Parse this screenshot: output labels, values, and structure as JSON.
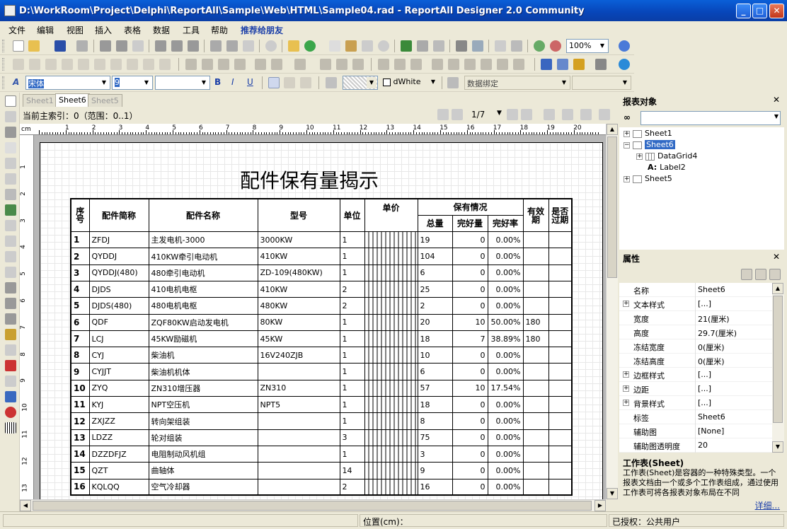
{
  "window": {
    "title": "D:\\WorkRoom\\Project\\Delphi\\ReportAll\\Sample\\Web\\HTML\\Sample04.rad - ReportAll Designer 2.0 Community"
  },
  "menu": [
    "文件",
    "编辑",
    "视图",
    "插入",
    "表格",
    "数据",
    "工具",
    "帮助",
    "推荐给朋友"
  ],
  "toolbar": {
    "zoom": "100%",
    "font_name": "宋体",
    "font_size": "9",
    "bg_color": "dWhite",
    "data_bind_label": "数据绑定"
  },
  "tabs": [
    "Sheet1",
    "Sheet6",
    "Sheet5"
  ],
  "doc_status": "当前主索引：0（范围：0..1）",
  "pager": "1/7",
  "ruler": [
    "1",
    "2",
    "3",
    "4",
    "5",
    "6",
    "7",
    "8",
    "9",
    "10",
    "11",
    "12",
    "13",
    "14",
    "15",
    "16",
    "17",
    "18",
    "19",
    "20"
  ],
  "ruler_v": [
    "1",
    "2",
    "3",
    "4",
    "5",
    "6",
    "7",
    "8",
    "9",
    "10",
    "11",
    "12",
    "13"
  ],
  "ruler_unit": "cm",
  "report": {
    "title": "配件保有量揭示",
    "headers": {
      "seq": "序号",
      "short": "配件简称",
      "name": "配件名称",
      "model": "型号",
      "unit": "单位",
      "price": "单价",
      "holding": "保有情况",
      "total": "总量",
      "good": "完好量",
      "rate": "完好率",
      "valid": "有效期",
      "expired": "是否过期"
    },
    "rows": [
      {
        "n": "1",
        "short": "ZFDJ",
        "name": "主发电机-3000",
        "model": "3000KW",
        "unit": "1",
        "total": "19",
        "good": "0",
        "rate": "0.00%",
        "valid": ""
      },
      {
        "n": "2",
        "short": "QYDDJ",
        "name": "410KW牵引电动机",
        "model": "410KW",
        "unit": "1",
        "total": "104",
        "good": "0",
        "rate": "0.00%",
        "valid": ""
      },
      {
        "n": "3",
        "short": "QYDDJ(480)",
        "name": "480牵引电动机",
        "model": "ZD-109(480KW)",
        "unit": "1",
        "total": "6",
        "good": "0",
        "rate": "0.00%",
        "valid": ""
      },
      {
        "n": "4",
        "short": "DJDS",
        "name": "410电机电枢",
        "model": "410KW",
        "unit": "2",
        "total": "25",
        "good": "0",
        "rate": "0.00%",
        "valid": ""
      },
      {
        "n": "5",
        "short": "DJDS(480)",
        "name": "480电机电枢",
        "model": "480KW",
        "unit": "2",
        "total": "2",
        "good": "0",
        "rate": "0.00%",
        "valid": ""
      },
      {
        "n": "6",
        "short": "QDF",
        "name": "ZQF80KW启动发电机",
        "model": "80KW",
        "unit": "1",
        "total": "20",
        "good": "10",
        "rate": "50.00%",
        "valid": "180"
      },
      {
        "n": "7",
        "short": "LCJ",
        "name": "45KW励磁机",
        "model": "45KW",
        "unit": "1",
        "total": "18",
        "good": "7",
        "rate": "38.89%",
        "valid": "180"
      },
      {
        "n": "8",
        "short": "CYJ",
        "name": "柴油机",
        "model": "16V240ZJB",
        "unit": "1",
        "total": "10",
        "good": "0",
        "rate": "0.00%",
        "valid": ""
      },
      {
        "n": "9",
        "short": "CYJJT",
        "name": "柴油机机体",
        "model": "",
        "unit": "1",
        "total": "6",
        "good": "0",
        "rate": "0.00%",
        "valid": ""
      },
      {
        "n": "10",
        "short": "ZYQ",
        "name": "ZN310增压器",
        "model": "ZN310",
        "unit": "1",
        "total": "57",
        "good": "10",
        "rate": "17.54%",
        "valid": ""
      },
      {
        "n": "11",
        "short": "KYJ",
        "name": "NPT空压机",
        "model": "NPT5",
        "unit": "1",
        "total": "18",
        "good": "0",
        "rate": "0.00%",
        "valid": ""
      },
      {
        "n": "12",
        "short": "ZXJZZ",
        "name": "转向架组装",
        "model": "",
        "unit": "1",
        "total": "8",
        "good": "0",
        "rate": "0.00%",
        "valid": ""
      },
      {
        "n": "13",
        "short": "LDZZ",
        "name": "轮对组装",
        "model": "",
        "unit": "3",
        "total": "75",
        "good": "0",
        "rate": "0.00%",
        "valid": ""
      },
      {
        "n": "14",
        "short": "DZZDFJZ",
        "name": "电阻制动风机组",
        "model": "",
        "unit": "1",
        "total": "3",
        "good": "0",
        "rate": "0.00%",
        "valid": ""
      },
      {
        "n": "15",
        "short": "QZT",
        "name": "曲轴体",
        "model": "",
        "unit": "14",
        "total": "9",
        "good": "0",
        "rate": "0.00%",
        "valid": ""
      },
      {
        "n": "16",
        "short": "KQLQQ",
        "name": "空气冷却器",
        "model": "",
        "unit": "2",
        "total": "16",
        "good": "0",
        "rate": "0.00%",
        "valid": ""
      }
    ]
  },
  "objects_panel": {
    "title": "报表对象",
    "tree": [
      "Sheet1",
      "Sheet6",
      "DataGrid4",
      "Label2",
      "Sheet5"
    ]
  },
  "props_panel": {
    "title": "属性",
    "rows": [
      {
        "k": "名称",
        "v": "Sheet6",
        "exp": false
      },
      {
        "k": "文本样式",
        "v": "[...]",
        "exp": true
      },
      {
        "k": "宽度",
        "v": "21(厘米)",
        "exp": false
      },
      {
        "k": "高度",
        "v": "29.7(厘米)",
        "exp": false
      },
      {
        "k": "冻结宽度",
        "v": "0(厘米)",
        "exp": false
      },
      {
        "k": "冻结高度",
        "v": "0(厘米)",
        "exp": false
      },
      {
        "k": "边框样式",
        "v": "[...]",
        "exp": true
      },
      {
        "k": "边距",
        "v": "[...]",
        "exp": true
      },
      {
        "k": "背景样式",
        "v": "[...]",
        "exp": true
      },
      {
        "k": "标签",
        "v": "Sheet6",
        "exp": false
      },
      {
        "k": "辅助图",
        "v": "[None]",
        "exp": false
      },
      {
        "k": "辅助图透明度",
        "v": "20",
        "exp": false
      }
    ],
    "desc_title": "工作表(Sheet)",
    "desc_text": "工作表(Sheet)是容器的一种特殊类型。一个报表文档由一个或多个工作表组成，通过使用工作表可将各报表对象布局在不同",
    "detail_link": "详细..."
  },
  "statusbar": {
    "position": "位置(cm)：",
    "auth": "已授权：公共用户"
  }
}
